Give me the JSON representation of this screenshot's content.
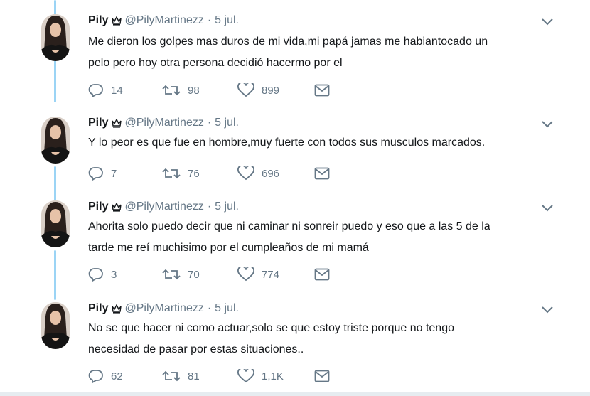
{
  "tweets": [
    {
      "name": "Pily",
      "handle": "@PilyMartinezz",
      "separator": "·",
      "date": "5 jul.",
      "text_lines": [
        "Me dieron los golpes mas duros de mi vida,mi papá jamas me habiantocado un",
        "pelo pero hoy otra persona decidió hacermo por el"
      ],
      "replies": "14",
      "retweets": "98",
      "likes": "899"
    },
    {
      "name": "Pily",
      "handle": "@PilyMartinezz",
      "separator": "·",
      "date": "5 jul.",
      "text_lines": [
        "Y lo peor es que fue en hombre,muy fuerte con todos sus musculos marcados."
      ],
      "replies": "7",
      "retweets": "76",
      "likes": "696"
    },
    {
      "name": "Pily",
      "handle": "@PilyMartinezz",
      "separator": "·",
      "date": "5 jul.",
      "text_lines": [
        "Ahorita solo puedo decir que ni caminar ni sonreir puedo y eso que a las 5 de la",
        "tarde me reí muchisimo por el cumpleaños de mi mamá"
      ],
      "replies": "3",
      "retweets": "70",
      "likes": "774"
    },
    {
      "name": "Pily",
      "handle": "@PilyMartinezz",
      "separator": "·",
      "date": "5 jul.",
      "text_lines": [
        "No se que hacer ni como actuar,solo se que estoy triste porque no tengo",
        "necesidad de pasar por estas situaciones.."
      ],
      "replies": "62",
      "retweets": "81",
      "likes": "1,1K"
    }
  ],
  "icons": {
    "crown": "crown-icon",
    "caret": "chevron-down-icon",
    "reply": "reply-icon",
    "retweet": "retweet-icon",
    "like": "heart-icon",
    "message": "envelope-icon"
  },
  "colors": {
    "thread_line": "#9bd4f5",
    "secondary_text": "#657786",
    "primary_text": "#14171a"
  }
}
